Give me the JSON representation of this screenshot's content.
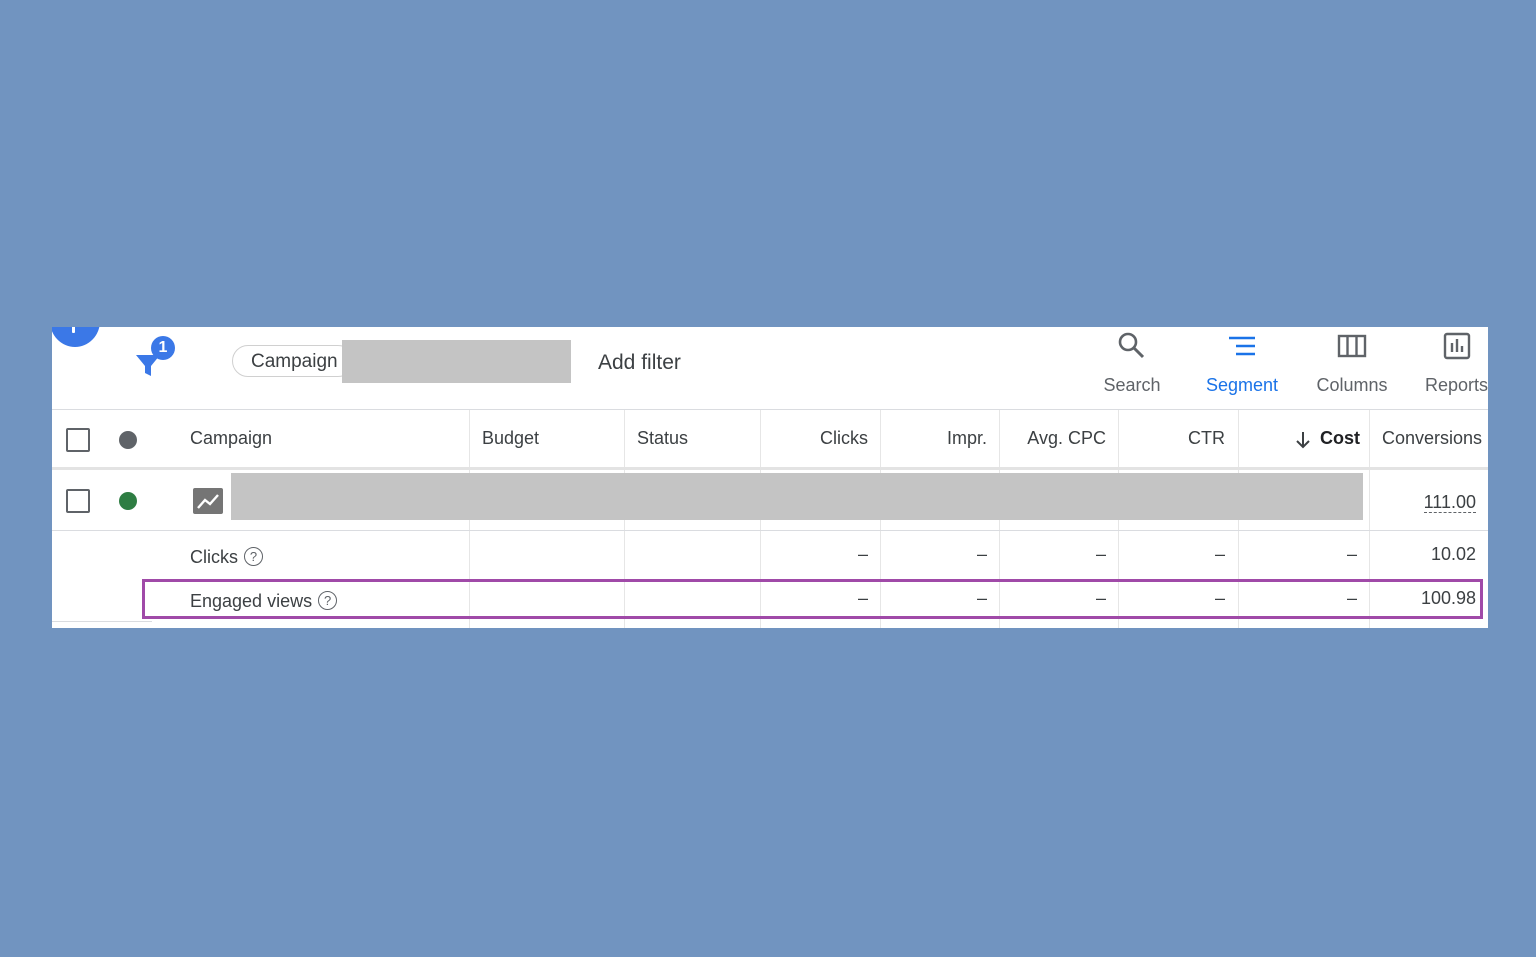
{
  "toolbar": {
    "filter_badge": "1",
    "chip_label": "Campaign",
    "add_filter": "Add filter",
    "tools": [
      {
        "label": "Search",
        "icon": "search-icon"
      },
      {
        "label": "Segment",
        "icon": "segment-icon"
      },
      {
        "label": "Columns",
        "icon": "columns-icon"
      },
      {
        "label": "Reports",
        "icon": "reports-icon"
      }
    ]
  },
  "colors": {
    "page_background": "#7194c0",
    "accent": "#1a73e8",
    "status_enabled": "#2e7d43",
    "highlight_border": "#a04aa8"
  },
  "table": {
    "headers": {
      "campaign": "Campaign",
      "budget": "Budget",
      "status": "Status",
      "clicks": "Clicks",
      "impr": "Impr.",
      "avg_cpc": "Avg. CPC",
      "ctr": "CTR",
      "cost": "Cost",
      "conversions": "Conversions"
    },
    "sort": {
      "column": "Cost",
      "direction": "descending",
      "icon": "arrow-down-icon"
    },
    "campaign_row": {
      "conversions": "111.00"
    },
    "segment_rows": [
      {
        "label": "Clicks",
        "clicks": "–",
        "impr": "–",
        "avg_cpc": "–",
        "ctr": "–",
        "cost": "–",
        "conversions": "10.02"
      },
      {
        "label": "Engaged views",
        "clicks": "–",
        "impr": "–",
        "avg_cpc": "–",
        "ctr": "–",
        "cost": "–",
        "conversions": "100.98"
      }
    ]
  }
}
